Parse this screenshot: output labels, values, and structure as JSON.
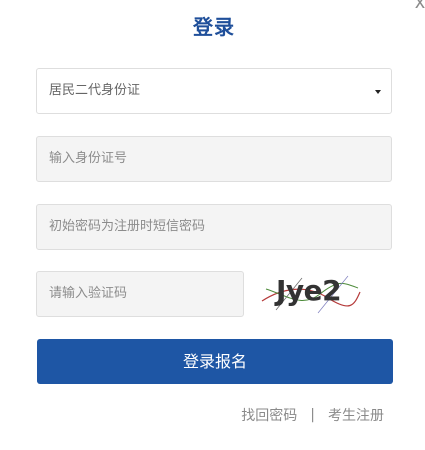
{
  "dialog": {
    "title": "登录",
    "close_label": "x"
  },
  "form": {
    "id_type_select": {
      "value": "居民二代身份证"
    },
    "id_number": {
      "placeholder": "输入身份证号"
    },
    "password": {
      "placeholder": "初始密码为注册时短信密码"
    },
    "captcha_input": {
      "placeholder": "请输入验证码"
    },
    "captcha_image_text": "Jye2",
    "submit_label": "登录报名"
  },
  "footer": {
    "forgot_password": "找回密码",
    "separator": "|",
    "register": "考生注册"
  },
  "colors": {
    "brand_blue": "#1e56a5",
    "title_blue": "#1f4f9a"
  }
}
